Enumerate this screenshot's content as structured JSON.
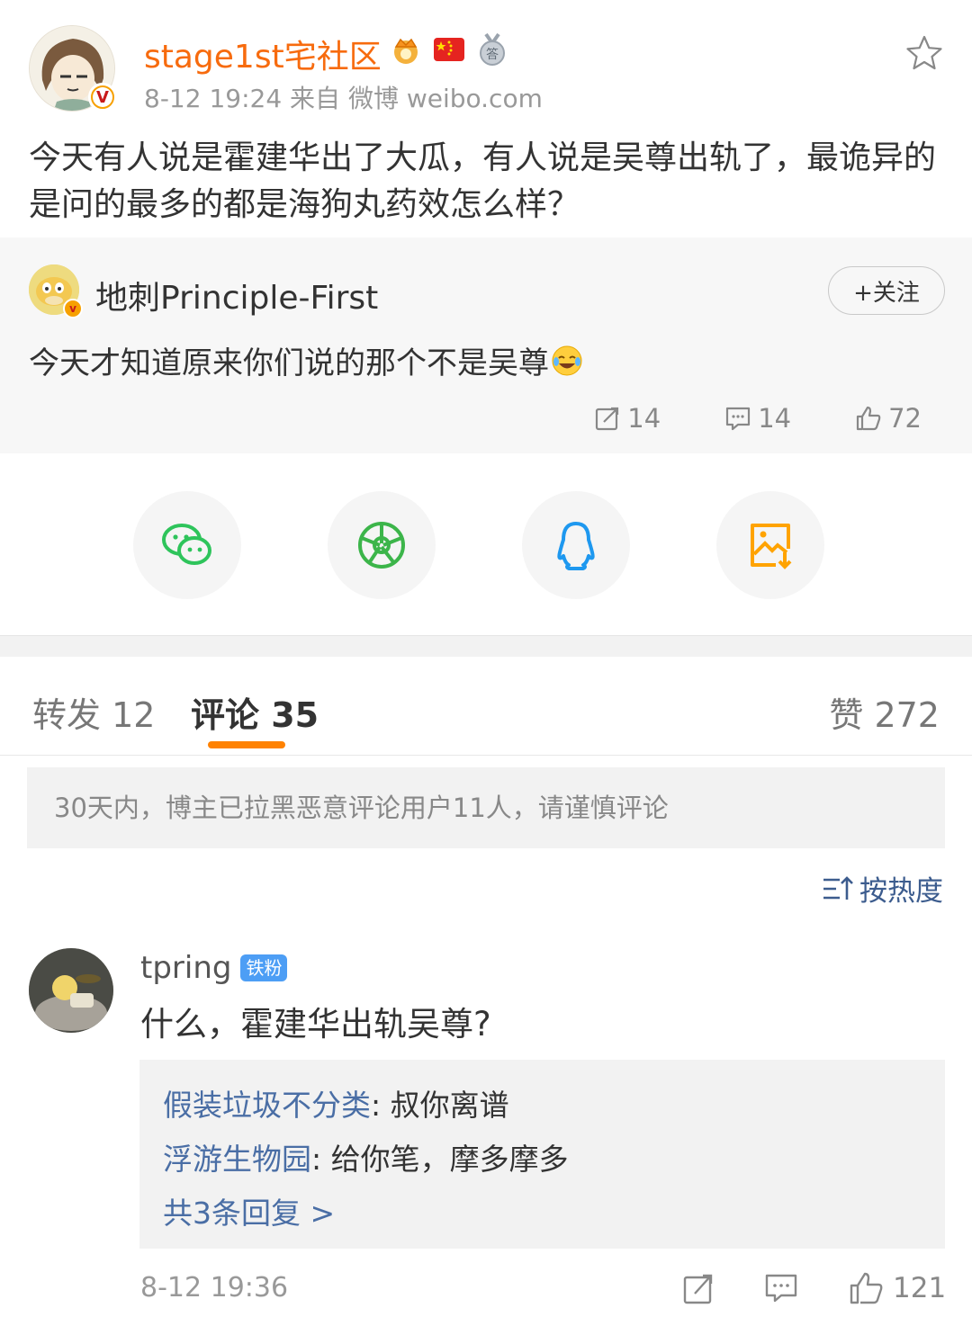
{
  "post": {
    "author": "stage1st宅社区",
    "meta": "8-12 19:24  来自 微博 weibo.com",
    "text": "今天有人说是霍建华出了大瓜，有人说是吴尊出轨了，最诡异的是问的最多的都是海狗丸药效怎么样？",
    "verify_mark": "V"
  },
  "retweet": {
    "author": "地刺Principle-First",
    "follow_label": "+关注",
    "text": "今天才知道原来你们说的那个不是吴尊",
    "verify_mark": "v",
    "actions": {
      "repost_count": "14",
      "comment_count": "14",
      "like_count": "72"
    }
  },
  "share": {
    "icons": [
      "wechat-icon",
      "moments-icon",
      "qq-icon",
      "save-image-icon"
    ],
    "colors": {
      "wechat": "#2ec45b",
      "moments": "#3cb54a",
      "qq": "#1e98ef",
      "save": "#ffa300"
    }
  },
  "tabs": {
    "repost": "转发 12",
    "comment": "评论 35",
    "like": "赞 272",
    "accent": "#ff8200"
  },
  "notice": "30天内，博主已拉黑恶意评论用户11人，请谨慎评论",
  "sort_label": "按热度",
  "comment": {
    "user": "tpring",
    "badge": "铁粉",
    "text": "什么，霍建华出轨吴尊?",
    "replies": [
      {
        "user": "假装垃圾不分类",
        "text": ": 叔你离谱"
      },
      {
        "user": "浮游生物园",
        "text": ": 给你笔，摩多摩多"
      }
    ],
    "more_replies": "共3条回复 >",
    "time": "8-12 19:36",
    "like_count": "121"
  }
}
